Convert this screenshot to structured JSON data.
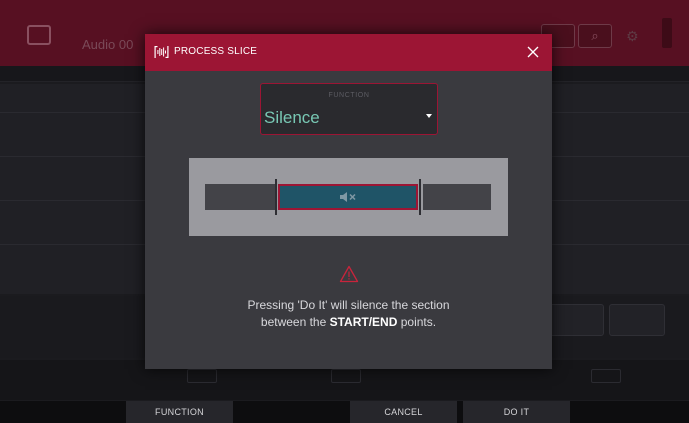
{
  "background_app": {
    "track_name": "Audio 00"
  },
  "dialog": {
    "title": "PROCESS SLICE",
    "function": {
      "label": "FUNCTION",
      "value": "Silence"
    },
    "message": {
      "line1": "Pressing 'Do It' will silence the section",
      "line2_before": "between the ",
      "line2_bold": "START/END",
      "line2_after": " points."
    }
  },
  "footer": {
    "function_label": "FUNCTION",
    "cancel_label": "CANCEL",
    "doit_label": "DO IT"
  },
  "icons": {
    "logo": "waveform-logo-icon",
    "close": "close-icon",
    "caret": "dropdown-caret-icon",
    "mute": "speaker-mute-icon",
    "warning": "warning-triangle-icon"
  },
  "colors": {
    "accent": "#9c1534",
    "header_bg": "#571022",
    "value_text": "#78c8b4",
    "selected_slice": "#1f5467",
    "dialog_bg": "#3a3a3f"
  }
}
